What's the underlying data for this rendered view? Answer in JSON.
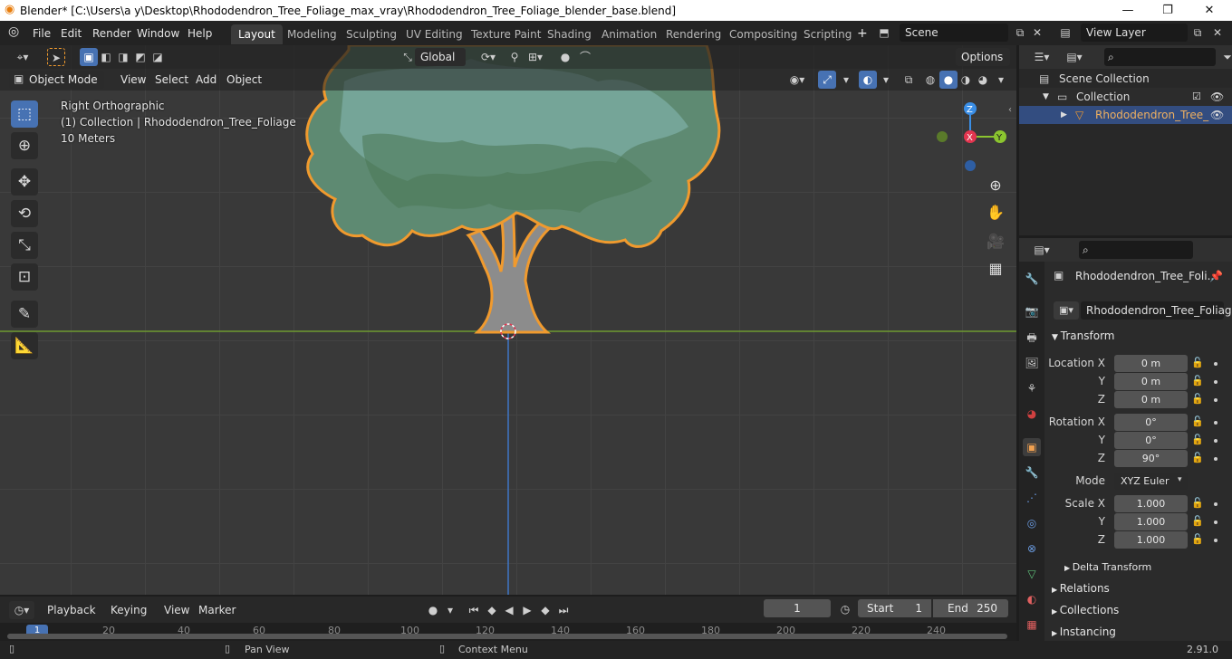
{
  "title_bar": {
    "text": "Blender* [C:\\Users\\a y\\Desktop\\Rhododendron_Tree_Foliage_max_vray\\Rhododendron_Tree_Foliage_blender_base.blend]",
    "minimize": "—",
    "maximize": "❐",
    "close": "✕"
  },
  "menu": [
    "File",
    "Edit",
    "Render",
    "Window",
    "Help"
  ],
  "workspaces": [
    "Layout",
    "Modeling",
    "Sculpting",
    "UV Editing",
    "Texture Paint",
    "Shading",
    "Animation",
    "Rendering",
    "Compositing",
    "Scripting"
  ],
  "scene": {
    "label": "Scene",
    "view_layer": "View Layer"
  },
  "viewport": {
    "mode": "Object Mode",
    "menus": [
      "View",
      "Select",
      "Add",
      "Object"
    ],
    "transform_orientation": "Global",
    "options": "Options",
    "overlay_lines": [
      "Right Orthographic",
      "(1) Collection | Rhododendron_Tree_Foliage",
      "10 Meters"
    ],
    "gizmo": {
      "z": "Z",
      "x": "X",
      "y": "Y"
    }
  },
  "outliner": {
    "items": [
      {
        "label": "Scene Collection"
      },
      {
        "label": "Collection"
      },
      {
        "label": "Rhododendron_Tree_"
      }
    ]
  },
  "properties": {
    "object_name": "Rhododendron_Tree_Foli...",
    "mesh_name": "Rhododendron_Tree_Foliage",
    "transform_title": "Transform",
    "location": {
      "label": "Location X",
      "y_label": "Y",
      "z_label": "Z",
      "x": "0 m",
      "y": "0 m",
      "z": "0 m"
    },
    "rotation": {
      "label": "Rotation X",
      "y_label": "Y",
      "z_label": "Z",
      "x": "0°",
      "y": "0°",
      "z": "90°"
    },
    "mode": {
      "label": "Mode",
      "value": "XYZ Euler"
    },
    "scale": {
      "label": "Scale X",
      "y_label": "Y",
      "z_label": "Z",
      "x": "1.000",
      "y": "1.000",
      "z": "1.000"
    },
    "sections": [
      "Delta Transform",
      "Relations",
      "Collections",
      "Instancing"
    ]
  },
  "timeline": {
    "menus": [
      "Playback",
      "Keying",
      "View",
      "Marker"
    ],
    "current_frame": "1",
    "start_label": "Start",
    "start": "1",
    "end_label": "End",
    "end": "250",
    "ruler": [
      "1",
      "20",
      "40",
      "60",
      "80",
      "100",
      "120",
      "140",
      "160",
      "180",
      "200",
      "220",
      "240"
    ]
  },
  "status": {
    "pan": "Pan View",
    "context": "Context Menu",
    "version": "2.91.0"
  },
  "colors": {
    "accent": "#4772b3",
    "selection": "#f09a2e",
    "x_axis": "#e2354f",
    "y_axis": "#8bc52f",
    "z_axis": "#3a8ee6"
  }
}
